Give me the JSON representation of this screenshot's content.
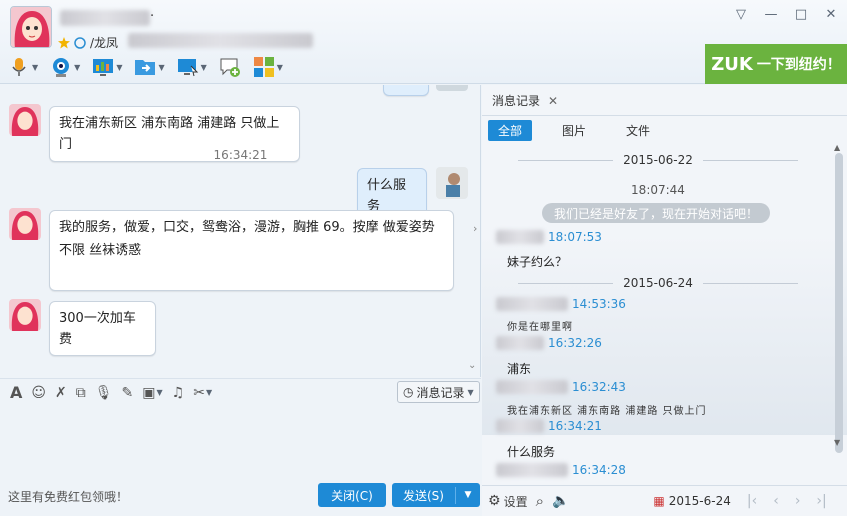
{
  "colors": {
    "accent": "#1e8ad6",
    "ad_green": "#6bb33f",
    "time_blue": "#2b8ed2"
  },
  "header": {
    "name_suffix": "·",
    "signature_prefix": "/龙凤",
    "window_controls": [
      "▽",
      "—",
      "□",
      "✕"
    ],
    "toolbar_icons": [
      "mic-icon",
      "camera-icon",
      "share-screen-icon",
      "send-file-icon",
      "remote-desktop-icon",
      "new-chat-icon",
      "apps-icon"
    ],
    "ad_text": "一下到纽约！",
    "ad_brand": "ZUK"
  },
  "chat": {
    "messages": [
      {
        "who": "peer",
        "text": "我在浦东新区 浦东南路 浦建路 只做上门"
      },
      {
        "who": "time",
        "text": "16:34:21"
      },
      {
        "who": "me",
        "text": "什么服务"
      },
      {
        "who": "peer",
        "text": "我的服务，做爱，口交，鸳鸯浴，漫游，胸推  69。按摩 做爱姿势"
      },
      {
        "who": "peer_cont",
        "text": "不限 丝袜诱惑"
      },
      {
        "who": "peer",
        "text": "300一次加车费"
      }
    ]
  },
  "input": {
    "tools": [
      "font-icon",
      "emoji-icon",
      "shake-icon",
      "screenshot-icon",
      "voice-icon",
      "edit-icon",
      "image-icon",
      "music-icon",
      "scissors-icon"
    ],
    "msg_log_label": "消息记录",
    "hint": "这里有免费红包领哦！",
    "close_label": "关闭(C)",
    "send_label": "发送(S)"
  },
  "history": {
    "tab_label": "消息记录",
    "filters": [
      "全部",
      "图片",
      "文件"
    ],
    "date1": "2015-06-22",
    "time1": "18:07:44",
    "system_msg": "我们已经是好友了，现在开始对话吧！",
    "e1_time": "18:07:53",
    "e1_text": "妹子约么？",
    "date2": "2015-06-24",
    "e2_time": "14:53:36",
    "e2_text": "你是在哪里啊",
    "e3_time": "16:32:26",
    "e3_text": "浦东",
    "e4_time": "16:32:43",
    "e4_text": "我在浦东新区  浦东南路  浦建路  只做上门",
    "e5_time": "16:34:21",
    "e5_text": "什么服务",
    "e6_time": "16:34:28",
    "settings_label": "设置",
    "current_date": "2015-6-24"
  }
}
